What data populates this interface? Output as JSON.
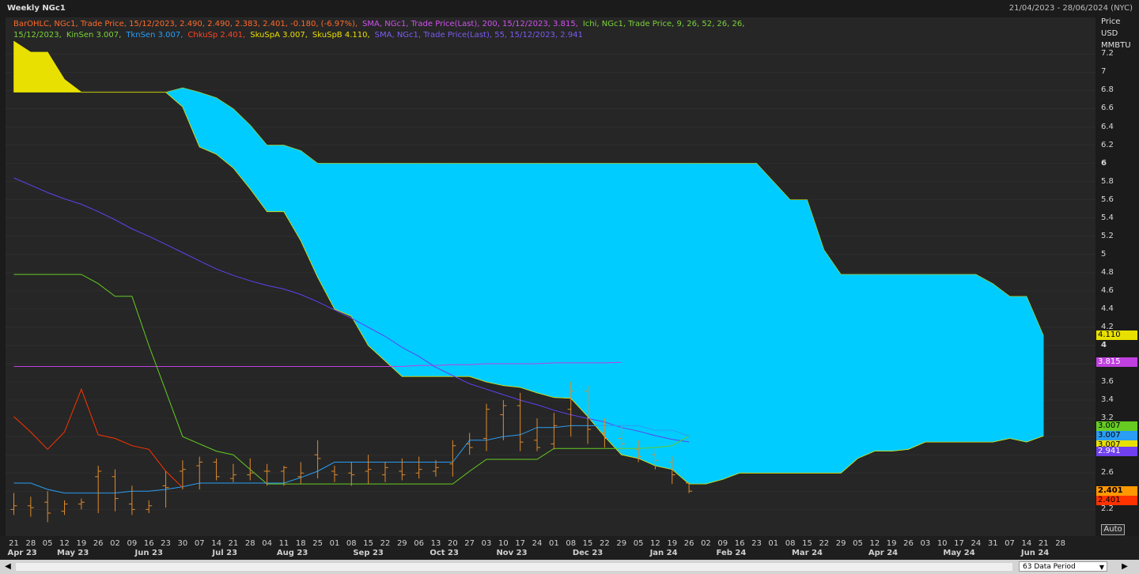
{
  "window": {
    "title": "Weekly NGc1",
    "date_range": "21/04/2023 - 28/06/2024 (NYC)"
  },
  "legend": {
    "bar": "BarOHLC, NGc1, Trade Price,  15/12/2023, 2.490, 2.490, 2.383, 2.401, -0.180, (-6.97%),",
    "sma200": "SMA, NGc1, Trade Price(Last),  200,  15/12/2023, 3.815,",
    "ichi": "Ichi, NGc1, Trade Price,  9,  26,  52,  26,  26,",
    "ichi_date": "15/12/2023,",
    "kinsen": "KinSen 3.007,",
    "tknsen": "TknSen 3.007,",
    "chku": "ChkuSp 2.401,",
    "skua": "SkuSpA 3.007,",
    "skub": "SkuSpB 4.110,",
    "sma55": "SMA, NGc1, Trade Price(Last),  55,  15/12/2023, 2.941"
  },
  "axis": {
    "unit_lines": [
      "Price",
      "USD",
      "MMBTU"
    ],
    "y_ticks": [
      "7.2",
      "7",
      "6.8",
      "6.6",
      "6.4",
      "6.2",
      "6",
      "5.8",
      "5.6",
      "5.4",
      "5.2",
      "5",
      "4.8",
      "4.6",
      "4.4",
      "4.2",
      "4",
      "3.8",
      "3.6",
      "3.4",
      "3.2",
      "3",
      "2.8",
      "2.6",
      "2.4",
      "2.2"
    ],
    "auto_label": "Auto",
    "x_week_ticks": [
      "21",
      "28",
      "05",
      "12",
      "19",
      "26",
      "02",
      "09",
      "16",
      "23",
      "30",
      "07",
      "14",
      "21",
      "28",
      "04",
      "11",
      "18",
      "25",
      "01",
      "08",
      "15",
      "22",
      "29",
      "06",
      "13",
      "20",
      "27",
      "03",
      "10",
      "17",
      "24",
      "01",
      "08",
      "15",
      "22",
      "29",
      "05",
      "12",
      "19",
      "26",
      "02",
      "09",
      "16",
      "23",
      "01",
      "08",
      "15",
      "22",
      "29",
      "05",
      "12",
      "19",
      "26",
      "03",
      "10",
      "17",
      "24",
      "31",
      "07",
      "14",
      "21",
      "28"
    ],
    "x_months": [
      "Apr 23",
      "May 23",
      "Jun 23",
      "Jul 23",
      "Aug 23",
      "Sep 23",
      "Oct 23",
      "Nov 23",
      "Dec 23",
      "Jan 24",
      "Feb 24",
      "Mar 24",
      "Apr 24",
      "May 24",
      "Jun 24"
    ]
  },
  "badges": [
    {
      "label": "4.110",
      "value": 4.11,
      "bg": "#e8e000",
      "fg": "#000000"
    },
    {
      "label": "3.815",
      "value": 3.815,
      "bg": "#c040e0",
      "fg": "#ffffff"
    },
    {
      "label": "3.007",
      "value": 3.007,
      "bg": "#66cc22",
      "fg": "#000000",
      "offset": -12
    },
    {
      "label": "3.007",
      "value": 3.007,
      "bg": "#2a9df4",
      "fg": "#000000"
    },
    {
      "label": "3.007",
      "value": 3.007,
      "bg": "#e8e000",
      "fg": "#000000",
      "offset": 12
    },
    {
      "label": "2.941",
      "value": 2.941,
      "bg": "#7040f0",
      "fg": "#ffffff",
      "offset": 12
    },
    {
      "label": "2.401",
      "value": 2.401,
      "bg": "#ff9900",
      "fg": "#000000",
      "bold": true
    },
    {
      "label": "2.401",
      "value": 2.401,
      "bg": "#ff3300",
      "fg": "#000000",
      "offset": 12
    }
  ],
  "scrollbar": {
    "period_label": "63 Data Period",
    "left_arrow": "◀",
    "right_arrow": "▶",
    "dropdown_arrow": "▼"
  },
  "colors": {
    "cloud": "#00ccff",
    "cloud_yellow": "#e8e000",
    "price_bars": "#e08a2c",
    "tenkan": "#2a9df4",
    "kijun": "#66cc22",
    "chikou": "#ff3300",
    "sma200": "#c040e0",
    "sma55": "#6040f0"
  },
  "chart_data": {
    "type": "line",
    "title": "Weekly NGc1",
    "ylabel": "Price USD MMBTU",
    "ylim": [
      2.0,
      7.4
    ],
    "x_range": [
      "2023-04-21",
      "2024-06-28"
    ],
    "ohlc": [
      {
        "o": 2.2,
        "h": 2.38,
        "l": 2.14,
        "c": 2.24
      },
      {
        "o": 2.24,
        "h": 2.34,
        "l": 2.12,
        "c": 2.22
      },
      {
        "o": 2.28,
        "h": 2.4,
        "l": 2.06,
        "c": 2.16
      },
      {
        "o": 2.18,
        "h": 2.3,
        "l": 2.14,
        "c": 2.26
      },
      {
        "o": 2.26,
        "h": 2.32,
        "l": 2.2,
        "c": 2.28
      },
      {
        "o": 2.56,
        "h": 2.68,
        "l": 2.16,
        "c": 2.62
      },
      {
        "o": 2.56,
        "h": 2.64,
        "l": 2.18,
        "c": 2.32
      },
      {
        "o": 2.26,
        "h": 2.46,
        "l": 2.14,
        "c": 2.2
      },
      {
        "o": 2.2,
        "h": 2.3,
        "l": 2.16,
        "c": 2.24
      },
      {
        "o": 2.46,
        "h": 2.62,
        "l": 2.22,
        "c": 2.44
      },
      {
        "o": 2.62,
        "h": 2.74,
        "l": 2.42,
        "c": 2.64
      },
      {
        "o": 2.68,
        "h": 2.78,
        "l": 2.42,
        "c": 2.72
      },
      {
        "o": 2.72,
        "h": 2.76,
        "l": 2.52,
        "c": 2.56
      },
      {
        "o": 2.54,
        "h": 2.7,
        "l": 2.5,
        "c": 2.58
      },
      {
        "o": 2.58,
        "h": 2.76,
        "l": 2.52,
        "c": 2.6
      },
      {
        "o": 2.62,
        "h": 2.7,
        "l": 2.46,
        "c": 2.62
      },
      {
        "o": 2.62,
        "h": 2.68,
        "l": 2.46,
        "c": 2.66
      },
      {
        "o": 2.56,
        "h": 2.72,
        "l": 2.48,
        "c": 2.6
      },
      {
        "o": 2.8,
        "h": 2.96,
        "l": 2.54,
        "c": 2.76
      },
      {
        "o": 2.62,
        "h": 2.68,
        "l": 2.5,
        "c": 2.58
      },
      {
        "o": 2.6,
        "h": 2.72,
        "l": 2.46,
        "c": 2.58
      },
      {
        "o": 2.62,
        "h": 2.8,
        "l": 2.48,
        "c": 2.64
      },
      {
        "o": 2.58,
        "h": 2.72,
        "l": 2.5,
        "c": 2.66
      },
      {
        "o": 2.62,
        "h": 2.76,
        "l": 2.52,
        "c": 2.58
      },
      {
        "o": 2.6,
        "h": 2.78,
        "l": 2.54,
        "c": 2.64
      },
      {
        "o": 2.62,
        "h": 2.74,
        "l": 2.56,
        "c": 2.66
      },
      {
        "o": 2.7,
        "h": 2.96,
        "l": 2.56,
        "c": 2.9
      },
      {
        "o": 2.92,
        "h": 3.04,
        "l": 2.8,
        "c": 2.88
      },
      {
        "o": 2.98,
        "h": 3.36,
        "l": 2.84,
        "c": 3.3
      },
      {
        "o": 3.24,
        "h": 3.4,
        "l": 2.96,
        "c": 3.34
      },
      {
        "o": 3.34,
        "h": 3.48,
        "l": 2.84,
        "c": 2.94
      },
      {
        "o": 2.96,
        "h": 3.2,
        "l": 2.84,
        "c": 2.88
      },
      {
        "o": 2.92,
        "h": 3.26,
        "l": 2.86,
        "c": 3.12
      },
      {
        "o": 3.3,
        "h": 3.6,
        "l": 3.0,
        "c": 3.5
      },
      {
        "o": 3.5,
        "h": 3.56,
        "l": 2.92,
        "c": 3.08
      },
      {
        "o": 3.04,
        "h": 3.2,
        "l": 2.88,
        "c": 2.98
      },
      {
        "o": 2.98,
        "h": 3.12,
        "l": 2.82,
        "c": 2.92
      },
      {
        "o": 2.86,
        "h": 2.96,
        "l": 2.72,
        "c": 2.78
      },
      {
        "o": 2.8,
        "h": 2.86,
        "l": 2.64,
        "c": 2.74
      },
      {
        "o": 2.72,
        "h": 2.78,
        "l": 2.48,
        "c": 2.58
      },
      {
        "o": 2.49,
        "h": 2.49,
        "l": 2.38,
        "c": 2.401
      }
    ],
    "series": [
      {
        "name": "TknSen",
        "start": 0,
        "values": [
          2.49,
          2.49,
          2.42,
          2.38,
          2.38,
          2.38,
          2.38,
          2.4,
          2.4,
          2.42,
          2.45,
          2.49,
          2.49,
          2.49,
          2.49,
          2.49,
          2.49,
          2.55,
          2.62,
          2.72,
          2.72,
          2.72,
          2.72,
          2.72,
          2.72,
          2.72,
          2.72,
          2.96,
          2.96,
          3.0,
          3.02,
          3.1,
          3.1,
          3.12,
          3.12,
          3.12,
          3.12,
          3.12,
          3.07,
          3.07,
          3.007
        ]
      },
      {
        "name": "KinSen",
        "start": 0,
        "values": [
          4.78,
          4.78,
          4.78,
          4.78,
          4.78,
          4.68,
          4.54,
          4.54,
          4.0,
          3.5,
          3.0,
          2.92,
          2.84,
          2.8,
          2.64,
          2.48,
          2.48,
          2.48,
          2.48,
          2.48,
          2.48,
          2.48,
          2.48,
          2.48,
          2.48,
          2.48,
          2.48,
          2.62,
          2.75,
          2.75,
          2.75,
          2.75,
          2.87,
          2.87,
          2.87,
          2.87,
          2.87,
          2.87,
          2.88,
          2.9,
          3.007
        ]
      },
      {
        "name": "ChkuSp",
        "start": 0,
        "values": [
          3.22,
          3.05,
          2.86,
          3.05,
          3.52,
          3.02,
          2.98,
          2.9,
          2.86,
          2.62,
          2.44
        ]
      },
      {
        "name": "SMA 200",
        "start": 0,
        "values": [
          3.77,
          3.77,
          3.77,
          3.77,
          3.77,
          3.77,
          3.77,
          3.77,
          3.77,
          3.77,
          3.77,
          3.77,
          3.77,
          3.77,
          3.77,
          3.77,
          3.77,
          3.77,
          3.77,
          3.77,
          3.77,
          3.77,
          3.77,
          3.77,
          3.78,
          3.78,
          3.79,
          3.79,
          3.8,
          3.8,
          3.8,
          3.8,
          3.81,
          3.81,
          3.81,
          3.81,
          3.815
        ]
      },
      {
        "name": "SMA 55",
        "start": 0,
        "values": [
          5.84,
          5.76,
          5.68,
          5.61,
          5.55,
          5.47,
          5.38,
          5.28,
          5.2,
          5.11,
          5.02,
          4.93,
          4.84,
          4.77,
          4.71,
          4.66,
          4.62,
          4.56,
          4.48,
          4.39,
          4.3,
          4.2,
          4.1,
          3.98,
          3.88,
          3.76,
          3.67,
          3.58,
          3.52,
          3.46,
          3.4,
          3.35,
          3.29,
          3.24,
          3.2,
          3.16,
          3.1,
          3.06,
          3.01,
          2.97,
          2.941
        ]
      },
      {
        "name": "SkuSpA",
        "start": 0,
        "values": [
          7.34,
          7.22,
          7.22,
          6.92,
          6.78,
          6.78,
          6.78,
          6.78,
          6.78,
          6.78,
          6.62,
          6.18,
          6.1,
          5.95,
          5.72,
          5.47,
          5.47,
          5.15,
          4.75,
          4.4,
          4.32,
          4.0,
          3.83,
          3.66,
          3.66,
          3.66,
          3.66,
          3.66,
          3.6,
          3.56,
          3.54,
          3.48,
          3.43,
          3.42,
          3.22,
          3.0,
          2.8,
          2.76,
          2.68,
          2.64,
          2.48,
          2.48,
          2.53,
          2.6,
          2.6,
          2.6,
          2.6,
          2.6,
          2.6,
          2.6,
          2.76,
          2.84,
          2.84,
          2.86,
          2.94,
          2.94,
          2.94,
          2.94,
          2.94,
          2.98,
          2.94,
          3.007
        ]
      },
      {
        "name": "SkuSpB",
        "start": 0,
        "values": [
          6.78,
          6.78,
          6.78,
          6.78,
          6.78,
          6.78,
          6.78,
          6.78,
          6.78,
          6.78,
          6.83,
          6.78,
          6.72,
          6.6,
          6.42,
          6.2,
          6.2,
          6.14,
          6.0,
          6.0,
          6.0,
          6.0,
          6.0,
          6.0,
          6.0,
          6.0,
          6.0,
          6.0,
          6.0,
          6.0,
          6.0,
          6.0,
          6.0,
          6.0,
          6.0,
          6.0,
          6.0,
          6.0,
          6.0,
          6.0,
          6.0,
          6.0,
          6.0,
          6.0,
          6.0,
          5.8,
          5.6,
          5.6,
          5.05,
          4.78,
          4.78,
          4.78,
          4.78,
          4.78,
          4.78,
          4.78,
          4.78,
          4.78,
          4.68,
          4.54,
          4.54,
          4.11
        ]
      }
    ]
  }
}
